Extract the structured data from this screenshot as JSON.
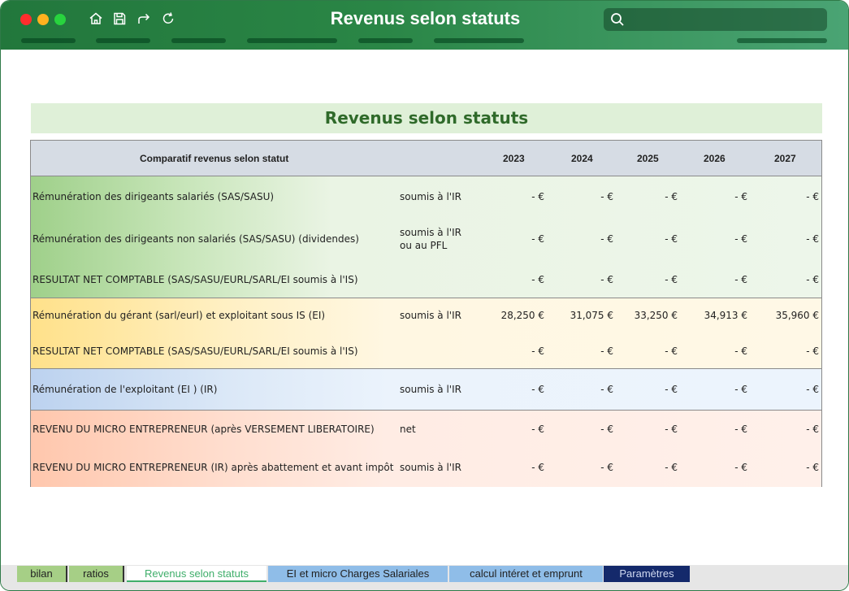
{
  "window": {
    "title": "Revenus selon statuts",
    "search_placeholder": ""
  },
  "toolbar_icons": [
    "home-icon",
    "save-icon",
    "redo-icon",
    "refresh-icon"
  ],
  "sheet": {
    "title": "Revenus selon statuts",
    "table": {
      "header": {
        "label": "Comparatif revenus selon statut",
        "years": [
          "2023",
          "2024",
          "2025",
          "2026",
          "2027"
        ]
      },
      "rows": [
        {
          "label": "Rémunération des dirigeants salariés (SAS/SASU)",
          "note": "soumis à l'IR",
          "values": [
            "-  €",
            "-  €",
            "-  €",
            "-  €",
            "-  €"
          ]
        },
        {
          "label": "Rémunération des dirigeants non salariés (SAS/SASU) (dividendes)",
          "note": "soumis à l'IR\nou au PFL",
          "values": [
            "-  €",
            "-  €",
            "-  €",
            "-  €",
            "-  €"
          ]
        },
        {
          "label": "RESULTAT NET COMPTABLE (SAS/SASU/EURL/SARL/EI soumis à l'IS)",
          "note": "",
          "values": [
            "-  €",
            "-  €",
            "-  €",
            "-  €",
            "-  €"
          ]
        },
        {
          "label": "Rémunération du gérant (sarl/eurl) et exploitant sous IS (EI)",
          "note": "soumis à l'IR",
          "values": [
            "28,250 €",
            "31,075 €",
            "33,250 €",
            "34,913 €",
            "35,960 €"
          ]
        },
        {
          "label": "RESULTAT NET COMPTABLE (SAS/SASU/EURL/SARL/EI soumis à l'IS)",
          "note": "",
          "values": [
            "-  €",
            "-  €",
            "-  €",
            "-  €",
            "-  €"
          ]
        },
        {
          "label": "Rémunération de l'exploitant (EI ) (IR)",
          "note": "soumis à l'IR",
          "values": [
            "-  €",
            "-  €",
            "-  €",
            "-  €",
            "-  €"
          ]
        },
        {
          "label": "REVENU DU  MICRO ENTREPRENEUR (après VERSEMENT LIBERATOIRE)",
          "note": "net",
          "values": [
            "-  €",
            "-  €",
            "-  €",
            "-  €",
            "-  €"
          ]
        },
        {
          "label": "REVENU DU  MICRO ENTREPRENEUR (IR) après abattement et avant impôt",
          "note": "soumis à l'IR",
          "values": [
            "-  €",
            "-  €",
            "-  €",
            "-  €",
            "-  €"
          ]
        }
      ]
    }
  },
  "tabs": [
    {
      "label": "bilan"
    },
    {
      "label": "ratios"
    },
    {
      "label": "Revenus selon statuts",
      "active": true
    },
    {
      "label": "EI et micro Charges Salariales"
    },
    {
      "label": "calcul intéret et emprunt"
    },
    {
      "label": "Paramètres"
    }
  ],
  "colors": {
    "titlebar": "#22773c",
    "group_salaries": "#9fd08a",
    "group_gerant": "#ffe18a",
    "group_exploitant": "#bcd2ef",
    "group_micro": "#ffc7ad"
  }
}
